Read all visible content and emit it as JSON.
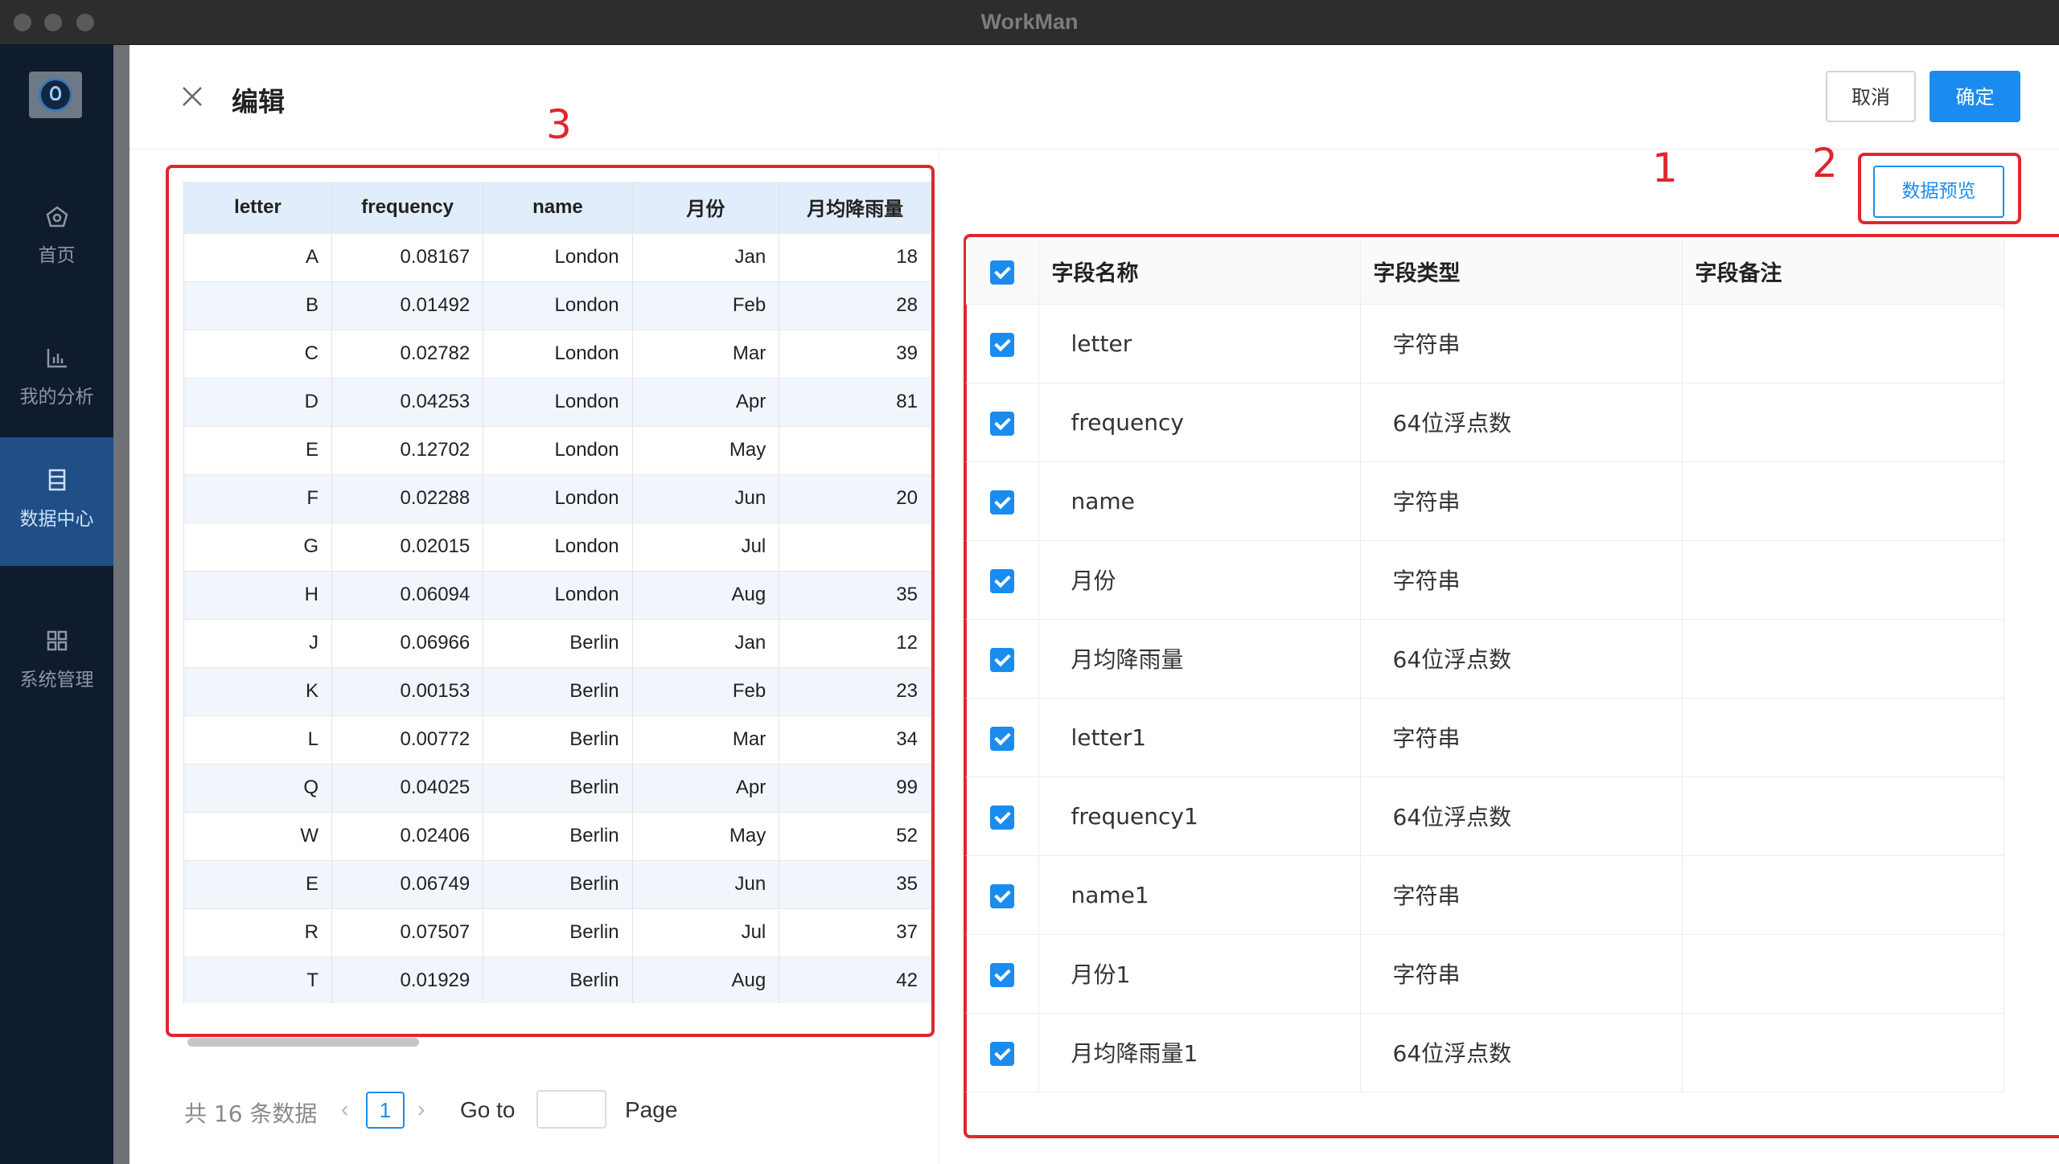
{
  "window": {
    "title": "WorkMan"
  },
  "sidebar": {
    "items": [
      {
        "label": "首页",
        "icon": "home-icon",
        "active": false
      },
      {
        "label": "我的分析",
        "icon": "bar-chart-icon",
        "active": false
      },
      {
        "label": "数据中心",
        "icon": "database-icon",
        "active": true
      },
      {
        "label": "系统管理",
        "icon": "grid-icon",
        "active": false
      }
    ]
  },
  "header": {
    "title": "编辑",
    "cancel_label": "取消",
    "confirm_label": "确定"
  },
  "annotations": {
    "n1": "1",
    "n2": "2",
    "n3": "3"
  },
  "preview": {
    "columns": [
      "letter",
      "frequency",
      "name",
      "月份",
      "月均降雨量"
    ],
    "rows": [
      [
        "A",
        "0.08167",
        "London",
        "Jan",
        "18"
      ],
      [
        "B",
        "0.01492",
        "London",
        "Feb",
        "28"
      ],
      [
        "C",
        "0.02782",
        "London",
        "Mar",
        "39"
      ],
      [
        "D",
        "0.04253",
        "London",
        "Apr",
        "81"
      ],
      [
        "E",
        "0.12702",
        "London",
        "May",
        ""
      ],
      [
        "F",
        "0.02288",
        "London",
        "Jun",
        "20"
      ],
      [
        "G",
        "0.02015",
        "London",
        "Jul",
        ""
      ],
      [
        "H",
        "0.06094",
        "London",
        "Aug",
        "35"
      ],
      [
        "J",
        "0.06966",
        "Berlin",
        "Jan",
        "12"
      ],
      [
        "K",
        "0.00153",
        "Berlin",
        "Feb",
        "23"
      ],
      [
        "L",
        "0.00772",
        "Berlin",
        "Mar",
        "34"
      ],
      [
        "Q",
        "0.04025",
        "Berlin",
        "Apr",
        "99"
      ],
      [
        "W",
        "0.02406",
        "Berlin",
        "May",
        "52"
      ],
      [
        "E",
        "0.06749",
        "Berlin",
        "Jun",
        "35"
      ],
      [
        "R",
        "0.07507",
        "Berlin",
        "Jul",
        "37"
      ],
      [
        "T",
        "0.01929",
        "Berlin",
        "Aug",
        "42"
      ]
    ]
  },
  "pager": {
    "total": "共 16 条数据",
    "prev": "‹",
    "page": "1",
    "next": "›",
    "goto": "Go to",
    "page_label": "Page",
    "goto_value": ""
  },
  "fields": {
    "preview_button": "数据预览",
    "columns": [
      "字段名称",
      "字段类型",
      "字段备注"
    ],
    "rows": [
      {
        "name": "letter",
        "type": "字符串",
        "note": ""
      },
      {
        "name": "frequency",
        "type": "64位浮点数",
        "note": ""
      },
      {
        "name": "name",
        "type": "字符串",
        "note": ""
      },
      {
        "name": "月份",
        "type": "字符串",
        "note": ""
      },
      {
        "name": "月均降雨量",
        "type": "64位浮点数",
        "note": ""
      },
      {
        "name": "letter1",
        "type": "字符串",
        "note": ""
      },
      {
        "name": "frequency1",
        "type": "64位浮点数",
        "note": ""
      },
      {
        "name": "name1",
        "type": "字符串",
        "note": ""
      },
      {
        "name": "月份1",
        "type": "字符串",
        "note": ""
      },
      {
        "name": "月均降雨量1",
        "type": "64位浮点数",
        "note": ""
      }
    ]
  },
  "colors": {
    "accent": "#1a8cf0",
    "sidebar": "#0f1c2e",
    "sidebar_active": "#1f4f86",
    "annotation": "#e0262e"
  }
}
